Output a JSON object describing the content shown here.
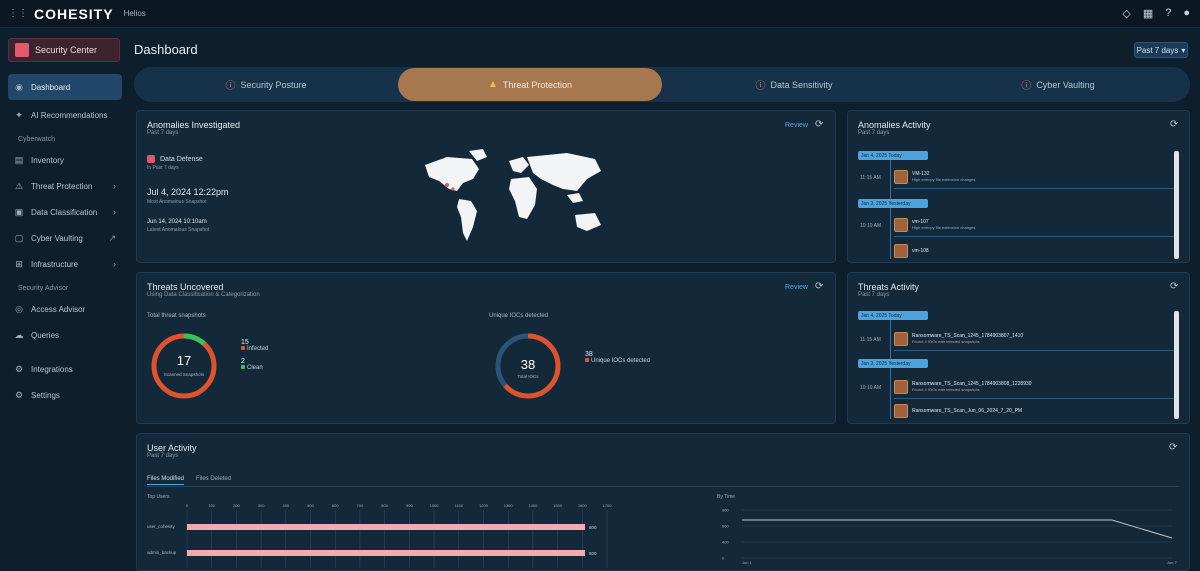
{
  "app": {
    "brand": "COHESITY",
    "brand_sub": "Helios",
    "app_switch_label": "Security Center",
    "page_title": "Dashboard",
    "range_select": "Past 7 days"
  },
  "sidebar": {
    "items_top": [
      {
        "label": "Dashboard",
        "icon": "dashboard-icon",
        "active": true
      },
      {
        "label": "AI Recommendations",
        "icon": "ai-icon"
      }
    ],
    "section_1": "Cyberwatch",
    "items_mid": [
      {
        "label": "Inventory",
        "icon": "inventory-icon",
        "chevron": false
      },
      {
        "label": "Threat Protection",
        "icon": "threat-icon",
        "chevron": true
      },
      {
        "label": "Data Classification",
        "icon": "classification-icon",
        "chevron": true
      },
      {
        "label": "Cyber Vaulting",
        "icon": "vault-icon",
        "external": true
      },
      {
        "label": "Infrastructure",
        "icon": "infrastructure-icon",
        "chevron": true
      }
    ],
    "section_2": "Security Advisor",
    "items_bottom": [
      {
        "label": "Access Advisor",
        "icon": "access-icon"
      },
      {
        "label": "Queries",
        "icon": "queries-icon"
      },
      {
        "label": "Integrations",
        "icon": "integrations-icon"
      },
      {
        "label": "Settings",
        "icon": "settings-icon"
      }
    ]
  },
  "tabs": [
    {
      "label": "Security Posture",
      "active": false
    },
    {
      "label": "Threat Protection",
      "active": true
    },
    {
      "label": "Data Sensitivity",
      "active": false
    },
    {
      "label": "Cyber Vaulting",
      "active": false
    }
  ],
  "anomalies": {
    "title": "Anomalies Investigated",
    "sub": "Past 7 days",
    "link": "Review",
    "name": "Data Defense",
    "name_sub": "In Past 7 days",
    "date": "Jul 4, 2024 12:22pm",
    "date_sub": "Most Anomalous Snapshot",
    "date2": "Jun 14, 2024 10:10am",
    "date2_sub": "Latest Anomalous Snapshot"
  },
  "anomalies_activity": {
    "title": "Anomalies Activity",
    "sub": "Past 7 days",
    "pills": [
      "Jan 4, 2025 Today",
      "Jan 3, 2025 Yesterday"
    ],
    "times": [
      "11:15 AM",
      "10:10 AM"
    ],
    "entries": [
      {
        "t1": "VM-132",
        "t2": "High entropy file extension changes"
      },
      {
        "t1": "vm-107",
        "t2": "High entropy file extension changes"
      },
      {
        "t1": "vm-108",
        "t2": ""
      }
    ]
  },
  "threats": {
    "title": "Threats Uncovered",
    "sub": "Using Data Classification & Categorization",
    "link": "Review",
    "left_label": "Total threat snapshots",
    "left_value": "17",
    "left_center_sub": "Scanned Snapshots",
    "left_legend": [
      {
        "num": "15",
        "label": "Infected",
        "color": "#e0532a"
      },
      {
        "num": "2",
        "label": "Clean",
        "color": "#3cbf5a"
      }
    ],
    "right_label": "Unique IOCs detected",
    "right_value": "38",
    "right_center_sub": "Total IOCs",
    "right_legend": [
      {
        "num": "38",
        "label": "Unique IOCs detected",
        "color": "#e0532a"
      }
    ]
  },
  "threats_activity": {
    "title": "Threats Activity",
    "sub": "Past 7 days",
    "pills": [
      "Jan 4, 2025 Today",
      "Jan 3, 2025 Yesterday"
    ],
    "times": [
      "11:15 AM",
      "10:10 AM"
    ],
    "entries": [
      {
        "t1": "Ransomware_TS_Scan_1245_1784903807_1410",
        "t2": "Found 4 IOCs with infected snapshots"
      },
      {
        "t1": "Ransomware_TS_Scan_1245_1784903808_1228930",
        "t2": "Found 4 IOCs with infected snapshots"
      },
      {
        "t1": "Ransomware_TS_Scan_Jun_06_2024_7_20_PM",
        "t2": ""
      }
    ]
  },
  "user_activity": {
    "title": "User Activity",
    "sub": "Past 7 days",
    "tabs": [
      "Files Modified",
      "Files Deleted"
    ],
    "left_chart_label": "Top Users",
    "right_chart_label": "By Time",
    "bars": [
      {
        "label": "user_cohesity",
        "value": "800"
      },
      {
        "label": "admin_backup",
        "value": "800"
      }
    ],
    "ticks": [
      "0",
      "100",
      "200",
      "300",
      "400",
      "500",
      "600",
      "700",
      "800",
      "900",
      "1000",
      "1100",
      "1200",
      "1300",
      "1400",
      "1500",
      "1600",
      "1700"
    ],
    "right_y_ticks": [
      "800",
      "600",
      "400",
      "0"
    ],
    "right_x_ticks": [
      "Jun 1",
      "Jun 7"
    ]
  },
  "colors": {
    "accent_tab": "#a7774f",
    "danger": "#e0532a",
    "ok": "#3cbf5a",
    "link": "#56a4e0"
  }
}
